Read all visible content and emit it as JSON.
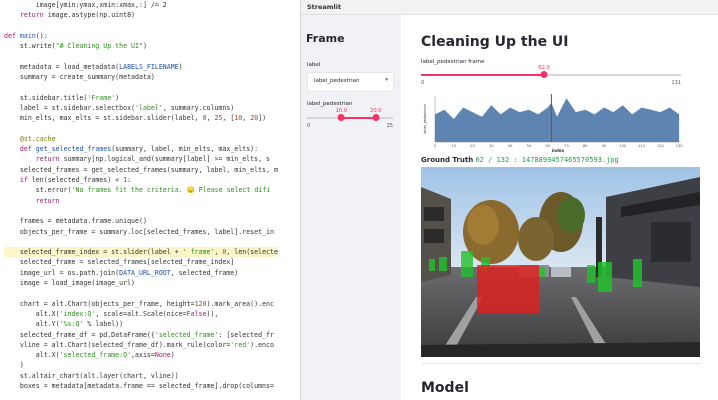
{
  "editor": {
    "lines": [
      {
        "parts": [
          {
            "t": "        image[ymin:ymax,xmin:xmax,:] /= 2",
            "c": ""
          }
        ]
      },
      {
        "parts": [
          {
            "t": "    ",
            "c": ""
          },
          {
            "t": "return",
            "c": "kw"
          },
          {
            "t": " image.astype(np.uint8)",
            "c": ""
          }
        ]
      },
      {
        "parts": [
          {
            "t": "",
            "c": ""
          }
        ]
      },
      {
        "parts": [
          {
            "t": "def",
            "c": "kw"
          },
          {
            "t": " ",
            "c": ""
          },
          {
            "t": "main",
            "c": "fn"
          },
          {
            "t": "():",
            "c": ""
          }
        ]
      },
      {
        "parts": [
          {
            "t": "    st.write(",
            "c": ""
          },
          {
            "t": "\"# Cleaning Up the UI\"",
            "c": "st"
          },
          {
            "t": ")",
            "c": ""
          }
        ]
      },
      {
        "parts": [
          {
            "t": "",
            "c": ""
          }
        ]
      },
      {
        "parts": [
          {
            "t": "    metadata = load_metadata(",
            "c": ""
          },
          {
            "t": "LABELS_FILENAME",
            "c": "fn"
          },
          {
            "t": ")",
            "c": ""
          }
        ]
      },
      {
        "parts": [
          {
            "t": "    summary = create_summary(metadata)",
            "c": ""
          }
        ]
      },
      {
        "parts": [
          {
            "t": "",
            "c": ""
          }
        ]
      },
      {
        "parts": [
          {
            "t": "    st.sidebar.title(",
            "c": ""
          },
          {
            "t": "'Frame'",
            "c": "st"
          },
          {
            "t": ")",
            "c": ""
          }
        ]
      },
      {
        "parts": [
          {
            "t": "    label = st.sidebar.selectbox(",
            "c": ""
          },
          {
            "t": "'label'",
            "c": "st"
          },
          {
            "t": ", summary.columns)",
            "c": ""
          }
        ]
      },
      {
        "parts": [
          {
            "t": "    min_elts, max_elts = st.sidebar.slider(label, ",
            "c": ""
          },
          {
            "t": "0",
            "c": "nm"
          },
          {
            "t": ", ",
            "c": ""
          },
          {
            "t": "25",
            "c": "nm"
          },
          {
            "t": ", [",
            "c": ""
          },
          {
            "t": "10",
            "c": "nm"
          },
          {
            "t": ", ",
            "c": ""
          },
          {
            "t": "20",
            "c": "nm"
          },
          {
            "t": "])",
            "c": ""
          }
        ]
      },
      {
        "parts": [
          {
            "t": "",
            "c": ""
          }
        ]
      },
      {
        "parts": [
          {
            "t": "    @st.cache",
            "c": "dc"
          }
        ]
      },
      {
        "parts": [
          {
            "t": "    ",
            "c": ""
          },
          {
            "t": "def",
            "c": "kw"
          },
          {
            "t": " ",
            "c": ""
          },
          {
            "t": "get_selected_frames",
            "c": "fn"
          },
          {
            "t": "(summary, label, min_elts, max_elts):",
            "c": ""
          }
        ]
      },
      {
        "parts": [
          {
            "t": "        ",
            "c": ""
          },
          {
            "t": "return",
            "c": "kw"
          },
          {
            "t": " summary[np.logical_and(summary[label] >= min_elts, s",
            "c": ""
          }
        ]
      },
      {
        "parts": [
          {
            "t": "    selected_frames = get_selected_frames(summary, label, min_elts, m",
            "c": ""
          }
        ]
      },
      {
        "parts": [
          {
            "t": "    ",
            "c": ""
          },
          {
            "t": "if",
            "c": "kw"
          },
          {
            "t": " len(selected_frames) < ",
            "c": ""
          },
          {
            "t": "1",
            "c": "nm"
          },
          {
            "t": ":",
            "c": ""
          }
        ]
      },
      {
        "parts": [
          {
            "t": "        st.error(",
            "c": ""
          },
          {
            "t": "'No frames fit the criteria. 😞 Please select difi",
            "c": "st"
          }
        ]
      },
      {
        "parts": [
          {
            "t": "        ",
            "c": ""
          },
          {
            "t": "return",
            "c": "kw"
          }
        ]
      },
      {
        "parts": [
          {
            "t": "",
            "c": ""
          }
        ]
      },
      {
        "parts": [
          {
            "t": "    frames = metadata.frame.unique()",
            "c": ""
          }
        ]
      },
      {
        "parts": [
          {
            "t": "    objects_per_frame = summary.loc[selected_frames, label].reset_in",
            "c": ""
          }
        ]
      },
      {
        "parts": [
          {
            "t": "",
            "c": ""
          }
        ]
      },
      {
        "parts": [
          {
            "t": "    selected_frame_index = st.slider(label + ",
            "c": ""
          },
          {
            "t": "' frame'",
            "c": "st"
          },
          {
            "t": ", ",
            "c": ""
          },
          {
            "t": "0",
            "c": "nm"
          },
          {
            "t": ", len(selecte",
            "c": ""
          }
        ],
        "hl": true
      },
      {
        "parts": [
          {
            "t": "    selected_frame = selected_frames[selected_frame_index]",
            "c": ""
          }
        ]
      },
      {
        "parts": [
          {
            "t": "    image_url = os.path.join(",
            "c": ""
          },
          {
            "t": "DATA_URL_ROOT",
            "c": "fn"
          },
          {
            "t": ", selected_frame)",
            "c": ""
          }
        ]
      },
      {
        "parts": [
          {
            "t": "    image = load_image(image_url)",
            "c": ""
          }
        ]
      },
      {
        "parts": [
          {
            "t": "",
            "c": ""
          }
        ]
      },
      {
        "parts": [
          {
            "t": "    chart = alt.Chart(objects_per_frame, height=",
            "c": ""
          },
          {
            "t": "120",
            "c": "nm"
          },
          {
            "t": ").mark_area().enc",
            "c": ""
          }
        ]
      },
      {
        "parts": [
          {
            "t": "        alt.X(",
            "c": ""
          },
          {
            "t": "'index:Q'",
            "c": "st"
          },
          {
            "t": ", scale=alt.Scale(nice=",
            "c": ""
          },
          {
            "t": "False",
            "c": "kw"
          },
          {
            "t": ")),",
            "c": ""
          }
        ]
      },
      {
        "parts": [
          {
            "t": "        alt.Y(",
            "c": ""
          },
          {
            "t": "'%s:Q'",
            "c": "st"
          },
          {
            "t": " % label))",
            "c": ""
          }
        ]
      },
      {
        "parts": [
          {
            "t": "    selected_frame_df = pd.DataFrame({",
            "c": ""
          },
          {
            "t": "'selected_frame'",
            "c": "st"
          },
          {
            "t": ": [selected_fr",
            "c": ""
          }
        ]
      },
      {
        "parts": [
          {
            "t": "    vline = alt.Chart(selected_frame_df).mark_rule(color=",
            "c": ""
          },
          {
            "t": "'red'",
            "c": "st"
          },
          {
            "t": ").enco",
            "c": ""
          }
        ]
      },
      {
        "parts": [
          {
            "t": "        alt.X(",
            "c": ""
          },
          {
            "t": "'selected_frame:Q'",
            "c": "st"
          },
          {
            "t": ",axis=",
            "c": ""
          },
          {
            "t": "None",
            "c": "kw"
          },
          {
            "t": ")",
            "c": ""
          }
        ]
      },
      {
        "parts": [
          {
            "t": "    )",
            "c": ""
          }
        ]
      },
      {
        "parts": [
          {
            "t": "    st.altair_chart(alt.layer(chart, vline))",
            "c": ""
          }
        ]
      },
      {
        "parts": [
          {
            "t": "    boxes = metadata[metadata.frame == selected_frame].drop(columns=",
            "c": ""
          }
        ]
      }
    ]
  },
  "app": {
    "bar_title": "Streamlit",
    "sidebar": {
      "title": "Frame",
      "select_label": "label",
      "select_value": "label_pedestrian",
      "chevron": "▾",
      "slider_label": "label_pedestrian",
      "slider": {
        "min": 0,
        "max": 25,
        "low": 10,
        "high": 20,
        "low_text": "10.0",
        "high_text": "20.0",
        "min_text": "0",
        "max_text": "25"
      }
    },
    "main": {
      "title": "Cleaning Up the UI",
      "frame_slider_label": "label_pedestrian frame",
      "frame_slider": {
        "min": 0,
        "max": 131,
        "value": 62,
        "value_text": "62.0",
        "min_text": "0",
        "max_text": "131"
      },
      "ground_truth_label": "Ground Truth",
      "ground_truth_code": "62 / 132 : 1478899457465570593.jpg",
      "model_title": "Model"
    },
    "accent": "#f63366"
  },
  "chart_data": {
    "type": "area",
    "ylabel": "label_pedestrian",
    "xlabel": "index",
    "x_ticks": [
      0,
      10,
      20,
      30,
      40,
      50,
      60,
      70,
      80,
      90,
      100,
      110,
      120,
      130
    ],
    "xlim": [
      0,
      131
    ],
    "selected_index": 62,
    "x": [
      0,
      5,
      10,
      15,
      20,
      25,
      30,
      35,
      40,
      45,
      50,
      55,
      60,
      62,
      65,
      70,
      75,
      80,
      85,
      90,
      95,
      100,
      105,
      110,
      115,
      120,
      125,
      130
    ],
    "values": [
      12,
      14,
      10,
      15,
      13,
      11,
      16,
      12,
      15,
      13,
      14,
      12,
      15,
      17,
      11,
      19,
      13,
      14,
      12,
      15,
      13,
      16,
      12,
      15,
      14,
      13,
      15,
      12
    ],
    "series_color": "#4c78a8"
  }
}
